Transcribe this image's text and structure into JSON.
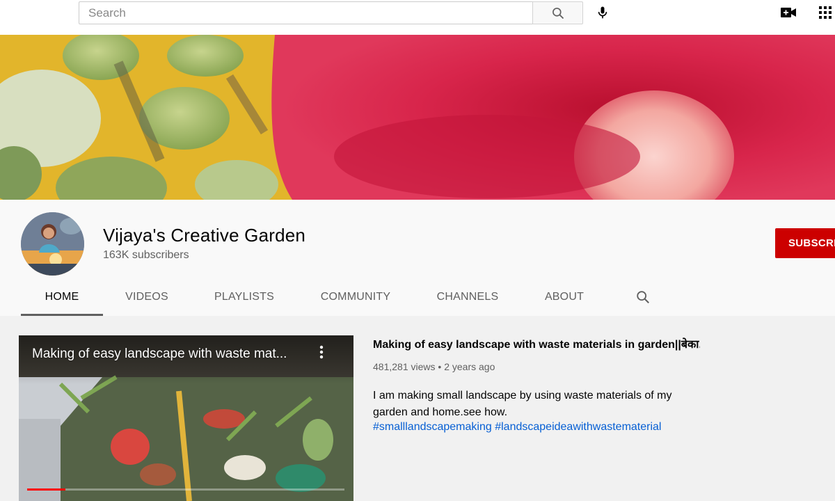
{
  "search": {
    "placeholder": "Search"
  },
  "channel": {
    "name": "Vijaya's Creative Garden",
    "subscribers": "163K subscribers",
    "subscribe_label": "SUBSCRIBE"
  },
  "tabs": [
    {
      "label": "HOME",
      "active": true
    },
    {
      "label": "VIDEOS",
      "active": false
    },
    {
      "label": "PLAYLISTS",
      "active": false
    },
    {
      "label": "COMMUNITY",
      "active": false
    },
    {
      "label": "CHANNELS",
      "active": false
    },
    {
      "label": "ABOUT",
      "active": false
    }
  ],
  "featured_video": {
    "player_title": "Making of easy landscape with waste mat...",
    "title": "Making of easy landscape with waste materials in garden||बेका...",
    "views": "481,281 views",
    "age": "2 years ago",
    "meta_separator": " • ",
    "description": "I am making small landscape by using waste materials of my garden and home.see how.",
    "hashtags": [
      "#smalllandscapemaking",
      "#landscapeideawithwastematerial"
    ],
    "progress": 0.12
  },
  "colors": {
    "subscribe": "#cc0000",
    "link": "#065fd4",
    "progress": "#ff0000"
  },
  "icons": {
    "search": "search-icon",
    "mic": "microphone-icon",
    "create": "video-camera-icon",
    "apps": "apps-grid-icon",
    "menu": "more-vertical-icon"
  }
}
